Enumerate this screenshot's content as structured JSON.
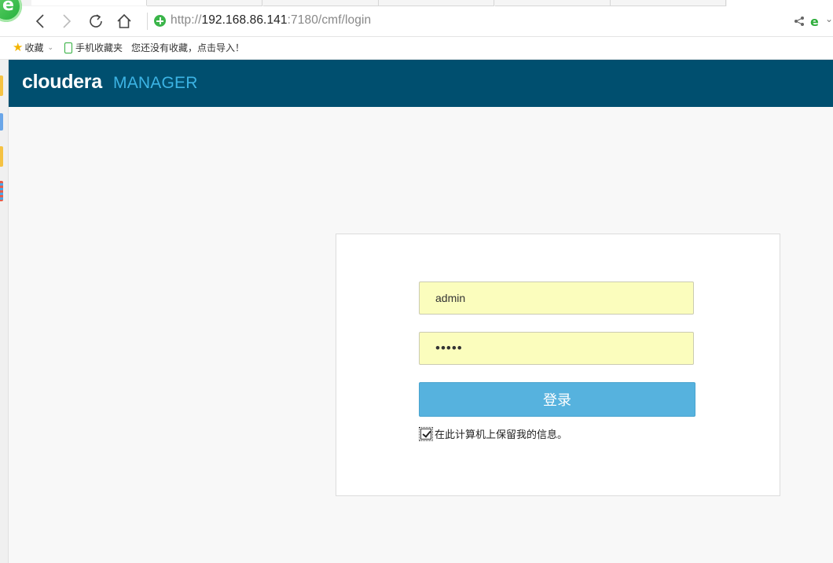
{
  "browser": {
    "url": {
      "protocol": "http://",
      "host": "192.168.86.141",
      "rest": ":7180/cmf/login"
    },
    "bookmarks_bar": {
      "favorites_label": "收藏",
      "mobile_favorites_label": "手机收藏夹",
      "import_hint": "您还没有收藏，点击导入！"
    }
  },
  "header": {
    "brand_primary": "cloudera",
    "brand_secondary": "MANAGER"
  },
  "login": {
    "username_value": "admin",
    "password_value": "•••••",
    "submit_label": "登录",
    "remember_checked": true,
    "remember_label": "在此计算机上保留我的信息。"
  },
  "colors": {
    "header_bg": "#004f6f",
    "brand_accent": "#3cb4e5",
    "button_bg": "#56b2de",
    "autofill_bg": "#fbfdbd"
  }
}
